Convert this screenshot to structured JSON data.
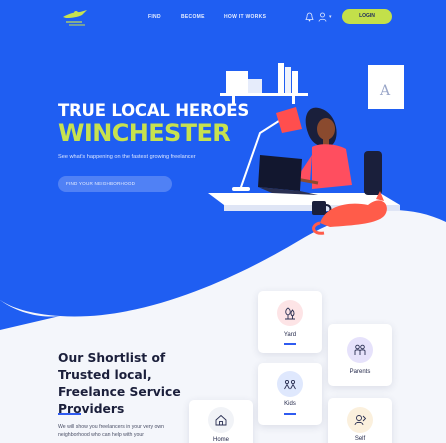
{
  "nav": {
    "links": [
      "FIND",
      "BECOME",
      "HOW IT WORKS"
    ],
    "login_label": "LOGIN"
  },
  "hero": {
    "title_line1": "TRUE LOCAL HEROES",
    "title_line2": "WINCHESTER",
    "subtitle": "See what's happening on the fastest growing freelancer",
    "search_placeholder": "FIND YOUR NEIGHBORHOOD"
  },
  "section": {
    "title": "Our Shortlist of Trusted local, Freelance Service Providers",
    "description": "We will show you freelancers in your very own neighborhood who can help with your"
  },
  "categories": [
    {
      "label": "Yard",
      "icon": "tree-icon"
    },
    {
      "label": "Parents",
      "icon": "family-icon"
    },
    {
      "label": "Kids",
      "icon": "children-icon"
    },
    {
      "label": "Home",
      "icon": "house-icon"
    },
    {
      "label": "Self",
      "icon": "person-icon"
    }
  ],
  "colors": {
    "hero_blue": "#1f5ef2",
    "accent_green": "#c7e24f",
    "text_dark": "#1b1f3b"
  },
  "icons": [
    "logo-icon",
    "bell-icon",
    "user-icon",
    "chevron-down-icon"
  ]
}
